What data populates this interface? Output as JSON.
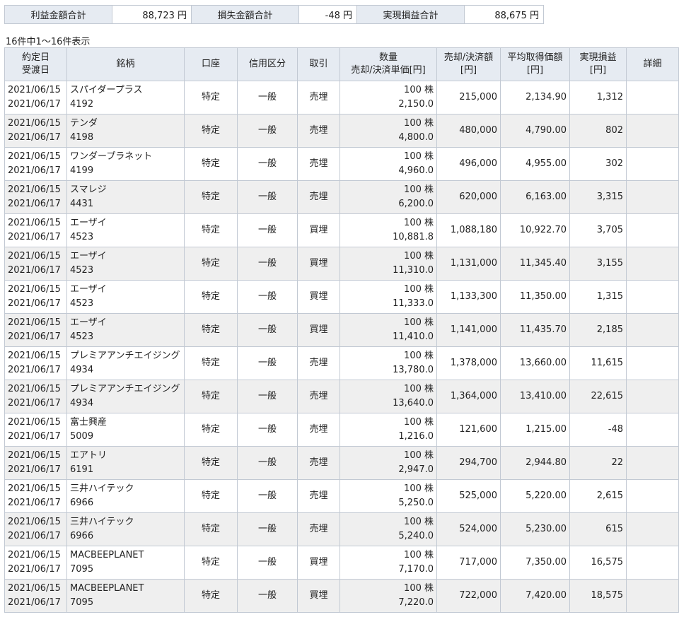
{
  "summary": {
    "profit_label": "利益金額合計",
    "profit_value": "88,723 円",
    "loss_label": "損失金額合計",
    "loss_value": "-48 円",
    "realized_label": "実現損益合計",
    "realized_value": "88,675 円"
  },
  "count_text": "16件中1～16件表示",
  "headers": {
    "date_1": "約定日",
    "date_2": "受渡日",
    "name": "銘柄",
    "account": "口座",
    "credit": "信用区分",
    "trade": "取引",
    "qty_1": "数量",
    "qty_2": "売却/決済単価[円]",
    "amount_1": "売却/決済額",
    "amount_2": "[円]",
    "avg_1": "平均取得価額",
    "avg_2": "[円]",
    "pl_1": "実現損益",
    "pl_2": "[円]",
    "detail": "詳細"
  },
  "rows": [
    {
      "trade_date": "2021/06/15",
      "settle_date": "2021/06/17",
      "name": "スパイダープラス",
      "code": "4192",
      "account": "特定",
      "credit": "一般",
      "trade": "売埋",
      "qty": "100 株",
      "price": "2,150.0",
      "amount": "215,000",
      "avg": "2,134.90",
      "pl": "1,312"
    },
    {
      "trade_date": "2021/06/15",
      "settle_date": "2021/06/17",
      "name": "テンダ",
      "code": "4198",
      "account": "特定",
      "credit": "一般",
      "trade": "売埋",
      "qty": "100 株",
      "price": "4,800.0",
      "amount": "480,000",
      "avg": "4,790.00",
      "pl": "802"
    },
    {
      "trade_date": "2021/06/15",
      "settle_date": "2021/06/17",
      "name": "ワンダープラネット",
      "code": "4199",
      "account": "特定",
      "credit": "一般",
      "trade": "売埋",
      "qty": "100 株",
      "price": "4,960.0",
      "amount": "496,000",
      "avg": "4,955.00",
      "pl": "302"
    },
    {
      "trade_date": "2021/06/15",
      "settle_date": "2021/06/17",
      "name": "スマレジ",
      "code": "4431",
      "account": "特定",
      "credit": "一般",
      "trade": "売埋",
      "qty": "100 株",
      "price": "6,200.0",
      "amount": "620,000",
      "avg": "6,163.00",
      "pl": "3,315"
    },
    {
      "trade_date": "2021/06/15",
      "settle_date": "2021/06/17",
      "name": "エーザイ",
      "code": "4523",
      "account": "特定",
      "credit": "一般",
      "trade": "買埋",
      "qty": "100 株",
      "price": "10,881.8",
      "amount": "1,088,180",
      "avg": "10,922.70",
      "pl": "3,705"
    },
    {
      "trade_date": "2021/06/15",
      "settle_date": "2021/06/17",
      "name": "エーザイ",
      "code": "4523",
      "account": "特定",
      "credit": "一般",
      "trade": "買埋",
      "qty": "100 株",
      "price": "11,310.0",
      "amount": "1,131,000",
      "avg": "11,345.40",
      "pl": "3,155"
    },
    {
      "trade_date": "2021/06/15",
      "settle_date": "2021/06/17",
      "name": "エーザイ",
      "code": "4523",
      "account": "特定",
      "credit": "一般",
      "trade": "買埋",
      "qty": "100 株",
      "price": "11,333.0",
      "amount": "1,133,300",
      "avg": "11,350.00",
      "pl": "1,315"
    },
    {
      "trade_date": "2021/06/15",
      "settle_date": "2021/06/17",
      "name": "エーザイ",
      "code": "4523",
      "account": "特定",
      "credit": "一般",
      "trade": "買埋",
      "qty": "100 株",
      "price": "11,410.0",
      "amount": "1,141,000",
      "avg": "11,435.70",
      "pl": "2,185"
    },
    {
      "trade_date": "2021/06/15",
      "settle_date": "2021/06/17",
      "name": "プレミアアンチエイジング",
      "code": "4934",
      "account": "特定",
      "credit": "一般",
      "trade": "売埋",
      "qty": "100 株",
      "price": "13,780.0",
      "amount": "1,378,000",
      "avg": "13,660.00",
      "pl": "11,615"
    },
    {
      "trade_date": "2021/06/15",
      "settle_date": "2021/06/17",
      "name": "プレミアアンチエイジング",
      "code": "4934",
      "account": "特定",
      "credit": "一般",
      "trade": "売埋",
      "qty": "100 株",
      "price": "13,640.0",
      "amount": "1,364,000",
      "avg": "13,410.00",
      "pl": "22,615"
    },
    {
      "trade_date": "2021/06/15",
      "settle_date": "2021/06/17",
      "name": "富士興産",
      "code": "5009",
      "account": "特定",
      "credit": "一般",
      "trade": "売埋",
      "qty": "100 株",
      "price": "1,216.0",
      "amount": "121,600",
      "avg": "1,215.00",
      "pl": "-48"
    },
    {
      "trade_date": "2021/06/15",
      "settle_date": "2021/06/17",
      "name": "エアトリ",
      "code": "6191",
      "account": "特定",
      "credit": "一般",
      "trade": "売埋",
      "qty": "100 株",
      "price": "2,947.0",
      "amount": "294,700",
      "avg": "2,944.80",
      "pl": "22"
    },
    {
      "trade_date": "2021/06/15",
      "settle_date": "2021/06/17",
      "name": "三井ハイテック",
      "code": "6966",
      "account": "特定",
      "credit": "一般",
      "trade": "売埋",
      "qty": "100 株",
      "price": "5,250.0",
      "amount": "525,000",
      "avg": "5,220.00",
      "pl": "2,615"
    },
    {
      "trade_date": "2021/06/15",
      "settle_date": "2021/06/17",
      "name": "三井ハイテック",
      "code": "6966",
      "account": "特定",
      "credit": "一般",
      "trade": "売埋",
      "qty": "100 株",
      "price": "5,240.0",
      "amount": "524,000",
      "avg": "5,230.00",
      "pl": "615"
    },
    {
      "trade_date": "2021/06/15",
      "settle_date": "2021/06/17",
      "name": "MACBEEPLANET",
      "code": "7095",
      "account": "特定",
      "credit": "一般",
      "trade": "買埋",
      "qty": "100 株",
      "price": "7,170.0",
      "amount": "717,000",
      "avg": "7,350.00",
      "pl": "16,575"
    },
    {
      "trade_date": "2021/06/15",
      "settle_date": "2021/06/17",
      "name": "MACBEEPLANET",
      "code": "7095",
      "account": "特定",
      "credit": "一般",
      "trade": "買埋",
      "qty": "100 株",
      "price": "7,220.0",
      "amount": "722,000",
      "avg": "7,420.00",
      "pl": "18,575"
    }
  ]
}
